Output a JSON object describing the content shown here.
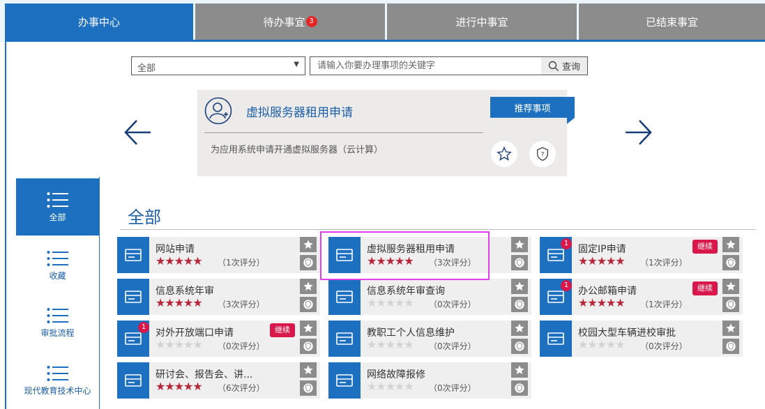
{
  "tabs": [
    {
      "label": "办事中心",
      "active": true
    },
    {
      "label": "待办事宜",
      "badge": "3"
    },
    {
      "label": "进行中事宜"
    },
    {
      "label": "已结束事宜"
    }
  ],
  "search": {
    "category": "全部",
    "placeholder": "请输入你要办理事项的关键字",
    "button_label": "查询"
  },
  "featured": {
    "title": "虚拟服务器租用申请",
    "description": "为应用系统申请开通虚拟服务器（云计算）",
    "tag": "推荐事项"
  },
  "sidebar": {
    "items": [
      {
        "label": "全部",
        "active": true
      },
      {
        "label": "收藏"
      },
      {
        "label": "审批流程"
      },
      {
        "label": "现代教育技术中心"
      }
    ]
  },
  "section": {
    "title": "全部"
  },
  "items": [
    {
      "name": "网站申请",
      "stars": 5,
      "count": "（1次评分）",
      "badge": "",
      "continue": ""
    },
    {
      "name": "虚拟服务器租用申请",
      "stars": 5,
      "count": "（3次评分）",
      "badge": "",
      "continue": ""
    },
    {
      "name": "固定IP申请",
      "stars": 5,
      "count": "（1次评分）",
      "badge": "1",
      "continue": "继续"
    },
    {
      "name": "信息系统年审",
      "stars": 5,
      "count": "（3次评分）",
      "badge": "",
      "continue": ""
    },
    {
      "name": "信息系统年审查询",
      "stars": 0,
      "count": "（0次评分）",
      "badge": "",
      "continue": ""
    },
    {
      "name": "办公邮箱申请",
      "stars": 5,
      "count": "（1次评分）",
      "badge": "1",
      "continue": "继续"
    },
    {
      "name": "对外开放端口申请",
      "stars": 0,
      "count": "（0次评分）",
      "badge": "1",
      "continue": "继续"
    },
    {
      "name": "教职工个人信息维护",
      "stars": 0,
      "count": "（0次评分）",
      "badge": "",
      "continue": ""
    },
    {
      "name": "校园大型车辆进校审批",
      "stars": 0,
      "count": "（0次评分）",
      "badge": "",
      "continue": ""
    },
    {
      "name": "研讨会、报告会、讲...",
      "stars": 5,
      "count": "（6次评分）",
      "badge": "",
      "continue": ""
    },
    {
      "name": "网络故障报修",
      "stars": 0,
      "count": "（0次评分）",
      "badge": "",
      "continue": ""
    }
  ],
  "colors": {
    "primary": "#1d6fbf",
    "accent": "#d9174a",
    "star": "#b8263a"
  }
}
